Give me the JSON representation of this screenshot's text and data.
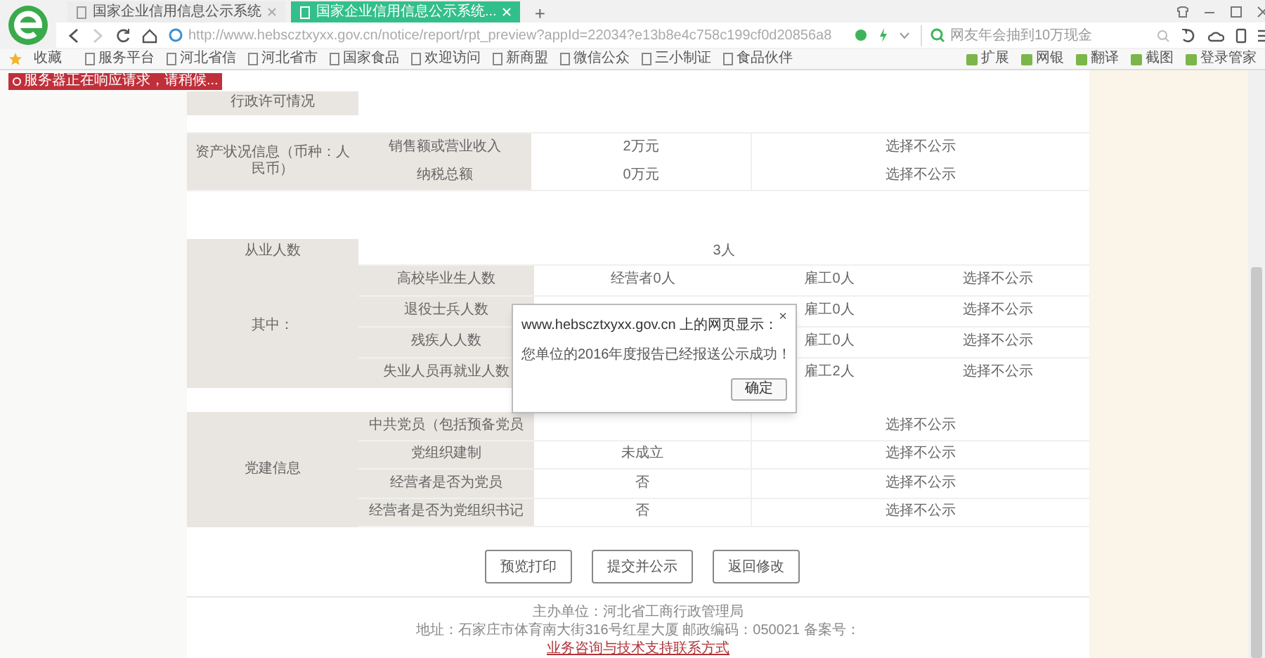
{
  "browser": {
    "tabs": [
      {
        "title": "国家企业信用信息公示系统",
        "selected": false
      },
      {
        "title": "国家企业信用信息公示系统...",
        "selected": true
      }
    ],
    "new_tab": "+",
    "address": "http://www.hebscztxyxx.gov.cn/notice/report/rpt_preview?appId=22034?e13b8e4c758c199cf0d20856a8",
    "search_placeholder": "网友年会抽到10万现金",
    "favorites": "收藏",
    "bookmarks": [
      "服务平台",
      "河北省信",
      "河北省市",
      "国家食品",
      "欢迎访问",
      "新商盟",
      "微信公众",
      "三小制证",
      "食品伙伴"
    ],
    "tools": [
      "扩展",
      "网银",
      "翻译",
      "截图",
      "登录管家"
    ]
  },
  "notification": "服务器正在响应请求，请稍候...",
  "permit": {
    "label": "行政许可情况"
  },
  "assets": {
    "label": "资产状况信息（币种：人民币）",
    "rows": [
      {
        "label": "销售额或营业收入",
        "value": "2万元",
        "status": "选择不公示"
      },
      {
        "label": "纳税总额",
        "value": "0万元",
        "status": "选择不公示"
      }
    ]
  },
  "employees": {
    "label": "从业人数",
    "total": "3人",
    "sub_label": "其中：",
    "rows": [
      {
        "label": "高校毕业生人数",
        "owner": "经营者0人",
        "staff": "雇工0人",
        "status": "选择不公示"
      },
      {
        "label": "退役士兵人数",
        "staff": "雇工0人",
        "status": "选择不公示"
      },
      {
        "label": "残疾人人数",
        "staff": "雇工0人",
        "status": "选择不公示"
      },
      {
        "label": "失业人员再就业人数",
        "staff": "雇工2人",
        "status": "选择不公示"
      }
    ]
  },
  "party": {
    "label": "党建信息",
    "rows": [
      {
        "label": "中共党员（包括预备党员",
        "status": "选择不公示"
      },
      {
        "label": "党组织建制",
        "value": "未成立",
        "status": "选择不公示"
      },
      {
        "label": "经营者是否为党员",
        "value": "否",
        "status": "选择不公示"
      },
      {
        "label": "经营者是否为党组织书记",
        "value": "否",
        "status": "选择不公示"
      }
    ]
  },
  "buttons": [
    "预览打印",
    "提交并公示",
    "返回修改"
  ],
  "footer": {
    "lines": [
      "主办单位：河北省工商行政管理局",
      "地址：石家庄市体育南大街316号红星大厦 邮政编码：050021 备案号："
    ],
    "link": "业务咨询与技术支持联系方式"
  },
  "dialog": {
    "title": "www.hebscztxyxx.gov.cn 上的网页显示：",
    "close": "×",
    "message": "您单位的2016年度报告已经报送公示成功！",
    "button": "确定"
  }
}
